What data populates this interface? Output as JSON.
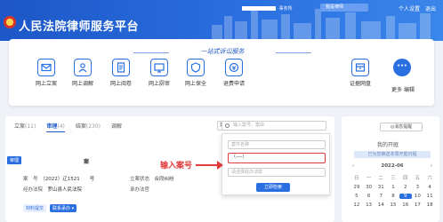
{
  "header": {
    "title": "人民法院律师服务平台",
    "user_suffix": "·事务所",
    "lawyer_btn": "我是律师",
    "links": [
      "个人设置",
      "退出"
    ]
  },
  "banner": {
    "slogan": "一站式诉讼服务",
    "services": [
      {
        "label": "网上立案",
        "icon": "mail-icon"
      },
      {
        "label": "网上调解",
        "icon": "people-icon"
      },
      {
        "label": "网上阅卷",
        "icon": "document-icon"
      },
      {
        "label": "网上厨审",
        "icon": "monitor-icon"
      },
      {
        "label": "网上保全",
        "icon": "shield-icon"
      },
      {
        "label": "退费申请",
        "icon": "refund-icon"
      },
      {
        "label": "证据网盘",
        "icon": "archive-icon"
      }
    ],
    "more_label": "更多",
    "edit_label": "编辑"
  },
  "cases": {
    "tabs": [
      {
        "label": "立案",
        "count": "(11)"
      },
      {
        "label": "审理",
        "count": "(4)"
      },
      {
        "label": "结案",
        "count": "(230)"
      },
      {
        "label": "调解",
        "count": ""
      }
    ],
    "case_type": "案件查询 ▾",
    "search_placeholder": "输入案号、案由",
    "dropdown": {
      "field1": "案件名称",
      "field2": "（----）",
      "field3": "请选择经办法院",
      "button": "立即检索"
    },
    "annotation": "输入案号",
    "card": {
      "badge": "审理",
      "title_end": "案",
      "case_no_label": "案　号",
      "case_no": "（2022）辽1521　　号",
      "court_label": "经办法院",
      "court": "罗山县人民法院",
      "status_label": "立案状态",
      "status": "合同纠纷",
      "agent_label": "承办法官",
      "tags": [
        "材料提交",
        "联系承办 ▾"
      ]
    }
  },
  "calendar": {
    "reminder_btn": "◎消息提醒",
    "title": "我的开庭",
    "subtitle": "已为您推送本周开庭日程",
    "month": "2022-06",
    "weekdays": [
      "日",
      "一",
      "二",
      "三",
      "四",
      "五",
      "六"
    ],
    "days": [
      "29",
      "30",
      "31",
      "1",
      "2",
      "3",
      "4",
      "5",
      "6",
      "7",
      "8",
      "9",
      "10",
      "11",
      "12",
      "13",
      "14",
      "15",
      "16",
      "17",
      "18"
    ],
    "today": "9"
  }
}
